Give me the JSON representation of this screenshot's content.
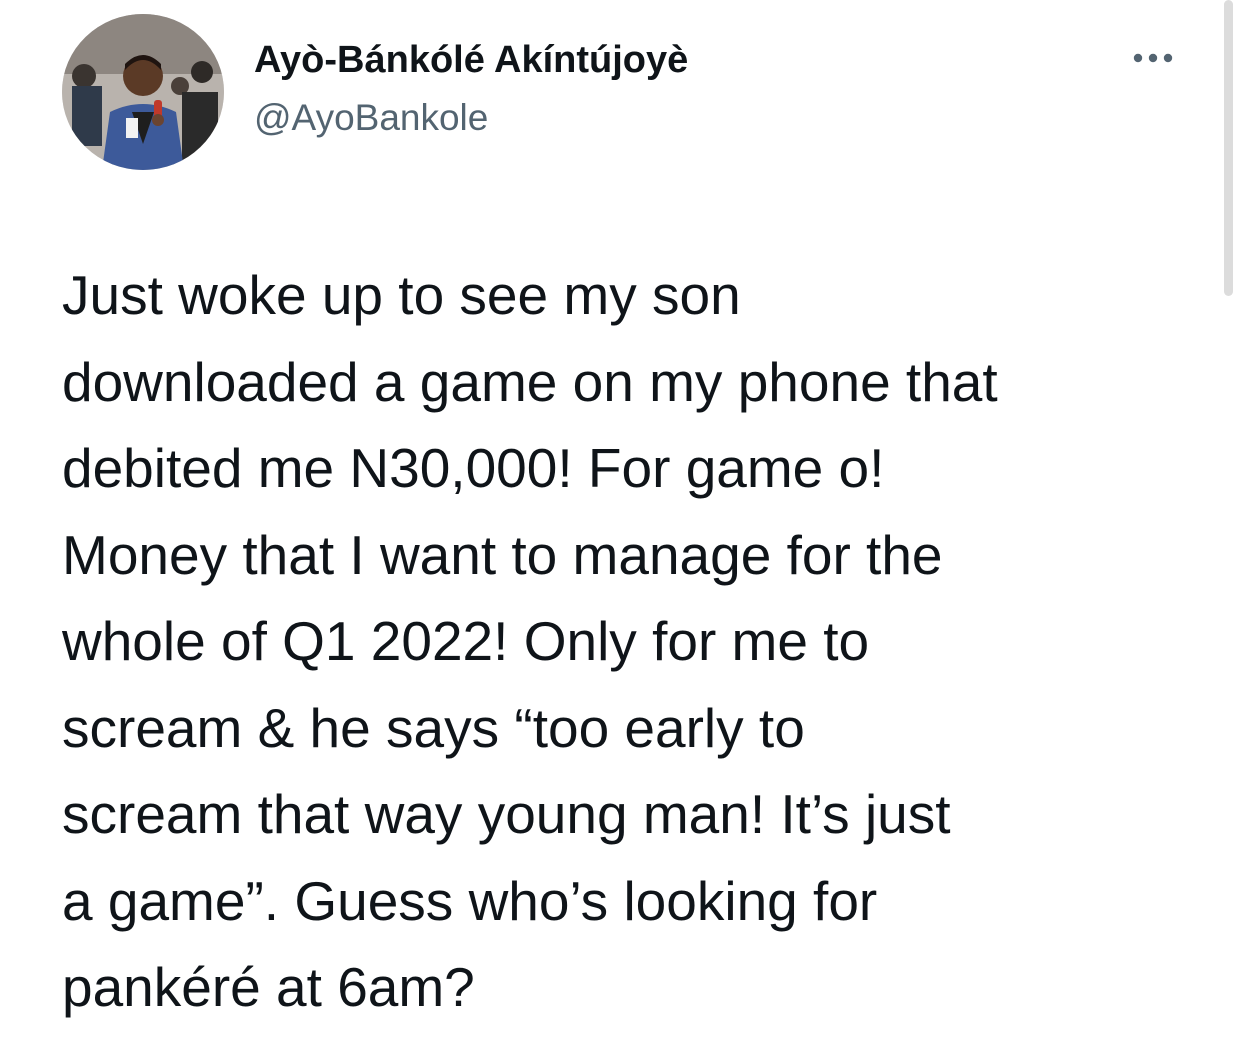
{
  "author": {
    "display_name": "Ayò-Bánkólé Akíntújoyè",
    "handle": "@AyoBankole"
  },
  "tweet": {
    "lines": [
      "Just woke up to see my son",
      "downloaded a game on my phone that",
      "debited me N30,000! For game o!",
      "Money that I want to manage for the",
      "whole of Q1 2022! Only for me to",
      "scream & he says “too early to",
      "scream that way young man! It’s just",
      "a game”. Guess who’s looking for",
      "pankéré at 6am?"
    ]
  },
  "icons": {
    "more": "more-horizontal-icon"
  },
  "colors": {
    "text_primary": "#0f1419",
    "text_secondary": "#536471",
    "background": "#ffffff"
  }
}
